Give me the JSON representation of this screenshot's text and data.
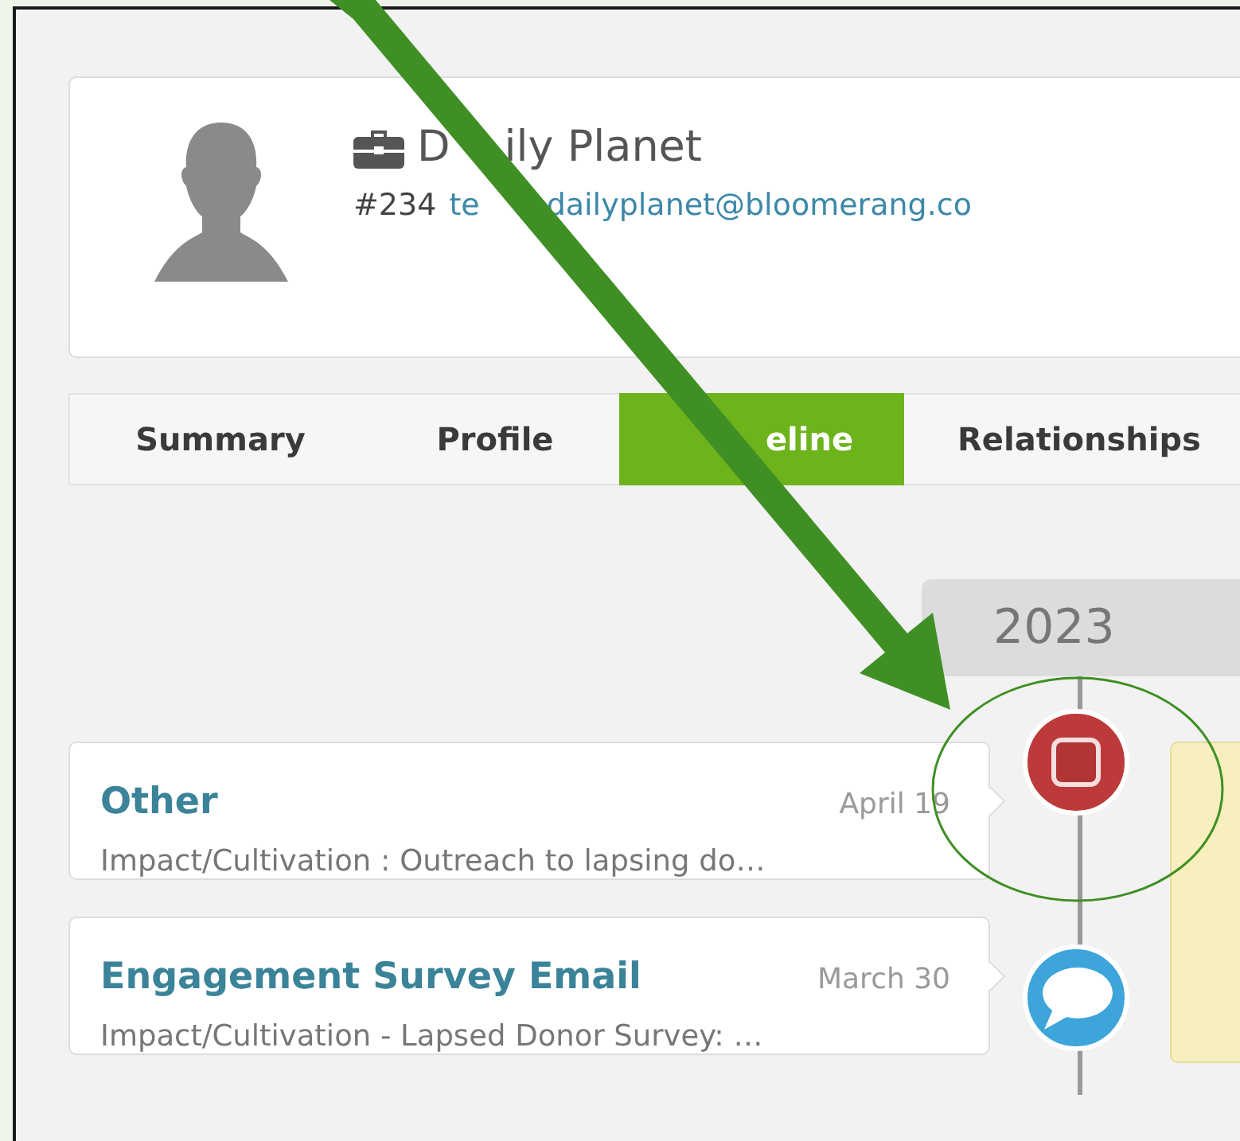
{
  "profile": {
    "name_fragments": [
      "D",
      "ily Planet"
    ],
    "number": "#234",
    "email_fragments": [
      "te",
      "dailyplanet@bloomerang.co"
    ]
  },
  "tabs": [
    {
      "label": "Summary",
      "selected": false
    },
    {
      "label": "Profile",
      "selected": false
    },
    {
      "label": "eline",
      "selected": true
    },
    {
      "label": "Relationships",
      "selected": false
    }
  ],
  "timeline": {
    "year": "2023",
    "entries": [
      {
        "kind": "task",
        "title": "Other",
        "date": "April 19",
        "summary": "Impact/Cultivation : Outreach to lapsing do…"
      },
      {
        "kind": "email",
        "title": "Engagement Survey Email",
        "date": "March 30",
        "summary": "Impact/Cultivation - Lapsed Donor Survey: …"
      }
    ]
  }
}
